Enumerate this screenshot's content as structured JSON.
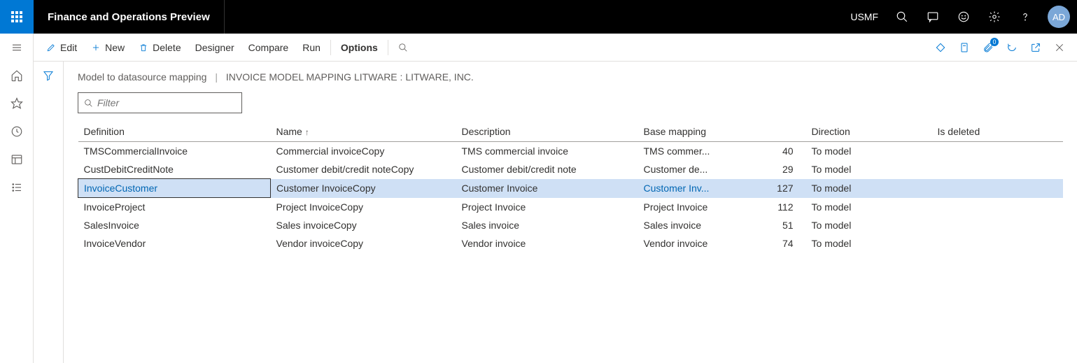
{
  "header": {
    "app_title": "Finance and Operations Preview",
    "legal_entity": "USMF",
    "avatar_initials": "AD"
  },
  "actions": {
    "edit": "Edit",
    "new": "New",
    "delete": "Delete",
    "designer": "Designer",
    "compare": "Compare",
    "run": "Run",
    "options": "Options",
    "attachments_badge": "0"
  },
  "breadcrumb": {
    "page": "Model to datasource mapping",
    "context": "INVOICE MODEL MAPPING LITWARE : LITWARE, INC."
  },
  "filter": {
    "placeholder": "Filter"
  },
  "grid": {
    "columns": {
      "definition": "Definition",
      "name": "Name",
      "description": "Description",
      "base_mapping": "Base mapping",
      "direction": "Direction",
      "is_deleted": "Is deleted"
    },
    "sort_column": "name",
    "rows": [
      {
        "definition": "TMSCommercialInvoice",
        "name": "Commercial invoiceCopy",
        "description": "TMS commercial invoice",
        "base_mapping": "TMS commer...",
        "num": "40",
        "direction": "To model",
        "is_deleted": "",
        "selected": false
      },
      {
        "definition": "CustDebitCreditNote",
        "name": "Customer debit/credit noteCopy",
        "description": "Customer debit/credit note",
        "base_mapping": "Customer de...",
        "num": "29",
        "direction": "To model",
        "is_deleted": "",
        "selected": false
      },
      {
        "definition": "InvoiceCustomer",
        "name": "Customer InvoiceCopy",
        "description": "Customer Invoice",
        "base_mapping": "Customer Inv...",
        "num": "127",
        "direction": "To model",
        "is_deleted": "",
        "selected": true
      },
      {
        "definition": "InvoiceProject",
        "name": "Project InvoiceCopy",
        "description": "Project Invoice",
        "base_mapping": "Project Invoice",
        "num": "112",
        "direction": "To model",
        "is_deleted": "",
        "selected": false
      },
      {
        "definition": "SalesInvoice",
        "name": "Sales invoiceCopy",
        "description": "Sales invoice",
        "base_mapping": "Sales invoice",
        "num": "51",
        "direction": "To model",
        "is_deleted": "",
        "selected": false
      },
      {
        "definition": "InvoiceVendor",
        "name": "Vendor invoiceCopy",
        "description": "Vendor invoice",
        "base_mapping": "Vendor invoice",
        "num": "74",
        "direction": "To model",
        "is_deleted": "",
        "selected": false
      }
    ]
  }
}
